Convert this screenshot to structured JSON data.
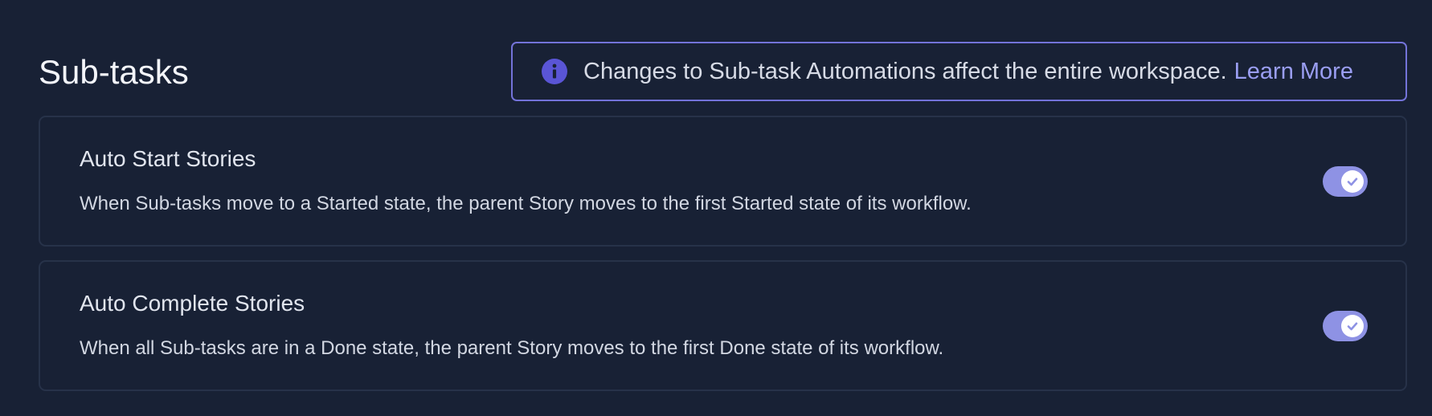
{
  "header": {
    "title": "Sub-tasks"
  },
  "notice": {
    "icon": "info-icon",
    "text": "Changes to Sub-task Automations affect the entire workspace.",
    "link_label": "Learn More"
  },
  "settings": [
    {
      "title": "Auto Start Stories",
      "description": "When Sub-tasks move to a Started state, the parent Story moves to the first Started state of its workflow.",
      "enabled": true
    },
    {
      "title": "Auto Complete Stories",
      "description": "When all Sub-tasks are in a Done state, the parent Story moves to the first Done state of its workflow.",
      "enabled": true
    }
  ],
  "colors": {
    "background": "#182135",
    "accent": "#7373d9",
    "toggle_on": "#8e92e4",
    "link": "#9a9ef2",
    "card_border": "#273249"
  }
}
